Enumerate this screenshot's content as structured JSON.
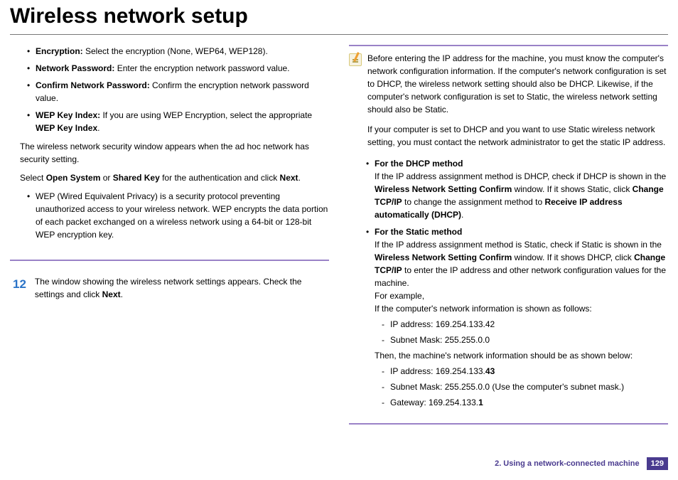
{
  "title": "Wireless network setup",
  "left": {
    "bullets": [
      {
        "label": "Encryption:",
        "text": " Select the encryption (None, WEP64, WEP128)."
      },
      {
        "label": "Network Password:",
        "text": " Enter the encryption network password value."
      },
      {
        "label": "Confirm Network Password:",
        "text": " Confirm the encryption network password value."
      },
      {
        "label": "WEP Key Index:",
        "text_pre": " If you are using WEP Encryption, select the appropriate ",
        "bold2": "WEP Key Index",
        "text_post": "."
      }
    ],
    "para1": "The wireless network security window appears when the ad hoc network has security setting.",
    "para2_pre": "Select ",
    "para2_b1": "Open System",
    "para2_mid": " or ",
    "para2_b2": "Shared Key",
    "para2_mid2": " for the authentication and click ",
    "para2_b3": "Next",
    "para2_post": ".",
    "wep_bullet": "WEP (Wired Equivalent Privacy) is a security protocol preventing unauthorized access to your wireless network. WEP encrypts the data portion of each packet exchanged on a wireless network using a 64-bit or 128-bit WEP encryption key.",
    "step": {
      "num": "12",
      "text_pre": "The window showing the wireless network settings appears. Check the settings and click ",
      "bold": "Next",
      "text_post": "."
    }
  },
  "right": {
    "note1": "Before entering the IP address for the machine, you must know the computer's network configuration information. If the computer's network configuration is set to DHCP, the wireless network setting should also be DHCP. Likewise, if the computer's network configuration is set to Static, the wireless network setting should also be Static.",
    "note2": "If your computer is set to DHCP and you want to use Static wireless network setting, you must contact the network administrator to get the static IP address.",
    "dhcp": {
      "title": "For the DHCP method",
      "p_pre": "If the IP address assignment method is DHCP, check if DHCP is shown in the ",
      "b1": "Wireless Network Setting Confirm",
      "p_mid": " window. If it shows Static, click ",
      "b2": "Change TCP/IP",
      "p_mid2": " to change the assignment method to ",
      "b3": "Receive IP address automatically (DHCP)",
      "p_post": "."
    },
    "static": {
      "title": "For the Static method",
      "p_pre": "If the IP address assignment method is Static, check if Static is shown in the ",
      "b1": "Wireless Network Setting Confirm",
      "p_mid": " window. If it shows DHCP, click ",
      "b2": "Change TCP/IP",
      "p_post": " to enter the IP address and other network configuration values for the machine.",
      "example_label": "For example,",
      "example_intro": "If the computer's network information is shown as follows:",
      "comp_ip": "IP address: 169.254.133.42",
      "comp_mask": "Subnet Mask: 255.255.0.0",
      "then_label": "Then, the machine's network information should be as shown below:",
      "mach_ip_pre": "IP address: 169.254.133.",
      "mach_ip_b": "43",
      "mach_mask": "Subnet Mask: 255.255.0.0 (Use the computer's subnet mask.)",
      "mach_gw_pre": "Gateway: 169.254.133.",
      "mach_gw_b": "1"
    }
  },
  "footer": {
    "chapter": "2.  Using a network-connected machine",
    "page": "129"
  }
}
